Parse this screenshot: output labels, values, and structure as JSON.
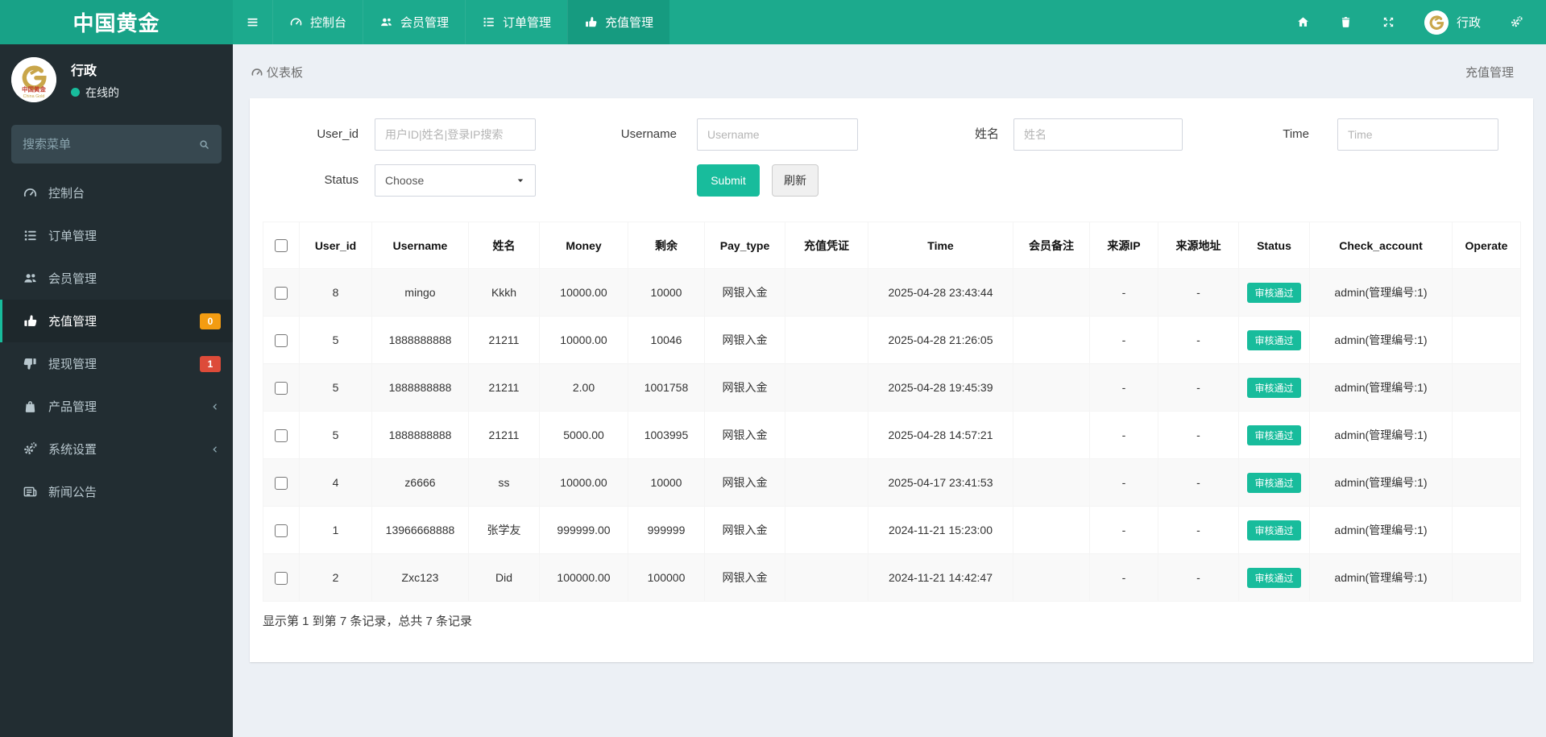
{
  "brand": {
    "logo_text": "中国黄金"
  },
  "navbar": {
    "tabs": [
      {
        "label": "控制台",
        "icon": "tachometer-icon",
        "active": false
      },
      {
        "label": "会员管理",
        "icon": "users-icon",
        "active": false
      },
      {
        "label": "订单管理",
        "icon": "list-ol-icon",
        "active": false
      },
      {
        "label": "充值管理",
        "icon": "thumbs-up-icon",
        "active": true
      }
    ],
    "right_icons": [
      "home-icon",
      "trash-icon",
      "expand-icon",
      "gears-icon"
    ],
    "user_label": "行政"
  },
  "sidebar": {
    "user": {
      "name": "行政",
      "status": "在线的"
    },
    "search_placeholder": "搜索菜单",
    "items": [
      {
        "label": "控制台",
        "icon": "tachometer-icon"
      },
      {
        "label": "订单管理",
        "icon": "list-ol-icon"
      },
      {
        "label": "会员管理",
        "icon": "users-icon"
      },
      {
        "label": "充值管理",
        "icon": "thumbs-up-icon",
        "active": true,
        "badge": "0",
        "badge_color": "#f39c12"
      },
      {
        "label": "提现管理",
        "icon": "thumbs-down-icon",
        "badge": "1",
        "badge_color": "#dd4b39"
      },
      {
        "label": "产品管理",
        "icon": "shopping-bag-icon",
        "chevron": true
      },
      {
        "label": "系统设置",
        "icon": "gears-icon",
        "chevron": true
      },
      {
        "label": "新闻公告",
        "icon": "newspaper-icon"
      }
    ]
  },
  "breadcrumb": {
    "left": "仪表板",
    "right": "充值管理"
  },
  "filters": {
    "user_id_label": "User_id",
    "user_id_placeholder": "用户ID|姓名|登录IP搜索",
    "username_label": "Username",
    "username_placeholder": "Username",
    "name_label": "姓名",
    "name_placeholder": "姓名",
    "time_label": "Time",
    "time_placeholder": "Time",
    "status_label": "Status",
    "status_value": "Choose",
    "submit_label": "Submit",
    "refresh_label": "刷新"
  },
  "table": {
    "columns": [
      "User_id",
      "Username",
      "姓名",
      "Money",
      "剩余",
      "Pay_type",
      "充值凭证",
      "Time",
      "会员备注",
      "来源IP",
      "来源地址",
      "Status",
      "Check_account",
      "Operate"
    ],
    "rows": [
      {
        "user_id": "8",
        "username": "mingo",
        "name": "Kkkh",
        "money": "10000.00",
        "remain": "10000",
        "pay_type": "网银入金",
        "voucher": "",
        "time": "2025-04-28 23:43:44",
        "member_note": "",
        "source_ip": "-",
        "source_addr": "-",
        "status": "审核通过",
        "check_account": "admin(管理编号:1)",
        "operate": ""
      },
      {
        "user_id": "5",
        "username": "1888888888",
        "name": "21211",
        "money": "10000.00",
        "remain": "10046",
        "pay_type": "网银入金",
        "voucher": "",
        "time": "2025-04-28 21:26:05",
        "member_note": "",
        "source_ip": "-",
        "source_addr": "-",
        "status": "审核通过",
        "check_account": "admin(管理编号:1)",
        "operate": ""
      },
      {
        "user_id": "5",
        "username": "1888888888",
        "name": "21211",
        "money": "2.00",
        "remain": "1001758",
        "pay_type": "网银入金",
        "voucher": "",
        "time": "2025-04-28 19:45:39",
        "member_note": "",
        "source_ip": "-",
        "source_addr": "-",
        "status": "审核通过",
        "check_account": "admin(管理编号:1)",
        "operate": ""
      },
      {
        "user_id": "5",
        "username": "1888888888",
        "name": "21211",
        "money": "5000.00",
        "remain": "1003995",
        "pay_type": "网银入金",
        "voucher": "",
        "time": "2025-04-28 14:57:21",
        "member_note": "",
        "source_ip": "-",
        "source_addr": "-",
        "status": "审核通过",
        "check_account": "admin(管理编号:1)",
        "operate": ""
      },
      {
        "user_id": "4",
        "username": "z6666",
        "name": "ss",
        "money": "10000.00",
        "remain": "10000",
        "pay_type": "网银入金",
        "voucher": "",
        "time": "2025-04-17 23:41:53",
        "member_note": "",
        "source_ip": "-",
        "source_addr": "-",
        "status": "审核通过",
        "check_account": "admin(管理编号:1)",
        "operate": ""
      },
      {
        "user_id": "1",
        "username": "13966668888",
        "name": "张学友",
        "money": "999999.00",
        "remain": "999999",
        "pay_type": "网银入金",
        "voucher": "",
        "time": "2024-11-21 15:23:00",
        "member_note": "",
        "source_ip": "-",
        "source_addr": "-",
        "status": "审核通过",
        "check_account": "admin(管理编号:1)",
        "operate": ""
      },
      {
        "user_id": "2",
        "username": "Zxc123",
        "name": "Did",
        "money": "100000.00",
        "remain": "100000",
        "pay_type": "网银入金",
        "voucher": "",
        "time": "2024-11-21 14:42:47",
        "member_note": "",
        "source_ip": "-",
        "source_addr": "-",
        "status": "审核通过",
        "check_account": "admin(管理编号:1)",
        "operate": ""
      }
    ]
  },
  "summary_text": "显示第 1 到第 7 条记录，总共 7 条记录",
  "colors": {
    "navbar": "#1caa8d",
    "navbar_logo_block": "#18a287",
    "navbar_active_tab": "#169b80",
    "sidebar_bg": "#222d32",
    "sidebar_active_bg": "#1e282c",
    "accent": "#18bc9c",
    "badge_orange": "#f39c12",
    "badge_red": "#dd4b39",
    "content_bg": "#ecf0f5"
  }
}
